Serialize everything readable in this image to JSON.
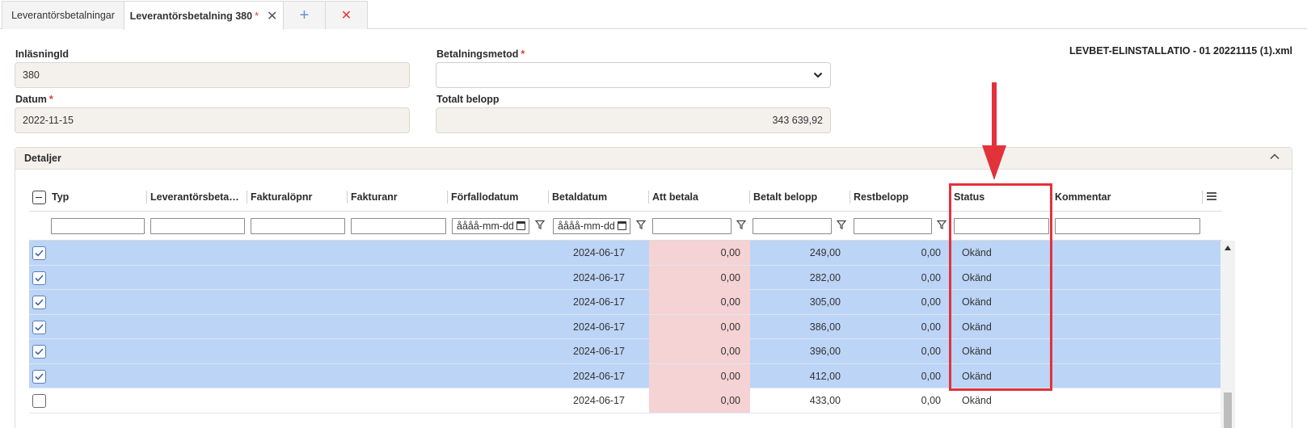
{
  "tabs": [
    {
      "label": "Leverantörsbetalningar"
    },
    {
      "label": "Leverantörsbetalning 380",
      "required_mark": "*",
      "close": "✕"
    },
    {
      "label": "+"
    },
    {
      "label": "✕"
    }
  ],
  "form": {
    "inlasning_label": "InläsningId",
    "inlasning_value": "380",
    "datum_label": "Datum",
    "datum_req": "*",
    "datum_value": "2022-11-15",
    "betalningsmetod_label": "Betalningsmetod",
    "betalningsmetod_req": "*",
    "betalningsmetod_value": "",
    "totalt_label": "Totalt belopp",
    "totalt_value": "343 639,92",
    "filename": "LEVBET-ELINSTALLATIO - 01 20221115 (1).xml"
  },
  "panel": {
    "title": "Detaljer"
  },
  "grid": {
    "columns": [
      "Typ",
      "Leverantörsbeta…",
      "Fakturalöpnr",
      "Fakturanr",
      "Förfallodatum",
      "Betaldatum",
      "Att betala",
      "Betalt belopp",
      "Restbelopp",
      "Status",
      "Kommentar"
    ],
    "sort_icon": "↑",
    "date_placeholder": "åååå-mm-dd",
    "rows": [
      {
        "selected": true,
        "betaldatum": "2024-06-17",
        "att_betala": "0,00",
        "betalt": "249,00",
        "rest": "0,00",
        "status": "Okänd"
      },
      {
        "selected": true,
        "betaldatum": "2024-06-17",
        "att_betala": "0,00",
        "betalt": "282,00",
        "rest": "0,00",
        "status": "Okänd"
      },
      {
        "selected": true,
        "betaldatum": "2024-06-17",
        "att_betala": "0,00",
        "betalt": "305,00",
        "rest": "0,00",
        "status": "Okänd"
      },
      {
        "selected": true,
        "betaldatum": "2024-06-17",
        "att_betala": "0,00",
        "betalt": "386,00",
        "rest": "0,00",
        "status": "Okänd"
      },
      {
        "selected": true,
        "betaldatum": "2024-06-17",
        "att_betala": "0,00",
        "betalt": "396,00",
        "rest": "0,00",
        "status": "Okänd"
      },
      {
        "selected": true,
        "betaldatum": "2024-06-17",
        "att_betala": "0,00",
        "betalt": "412,00",
        "rest": "0,00",
        "status": "Okänd"
      },
      {
        "selected": false,
        "betaldatum": "2024-06-17",
        "att_betala": "0,00",
        "betalt": "433,00",
        "rest": "0,00",
        "status": "Okänd"
      }
    ]
  },
  "colors": {
    "selected_row": "#bcd4f6",
    "att_betala_bg": "#f5d2d4",
    "annotation": "#e2323a"
  }
}
